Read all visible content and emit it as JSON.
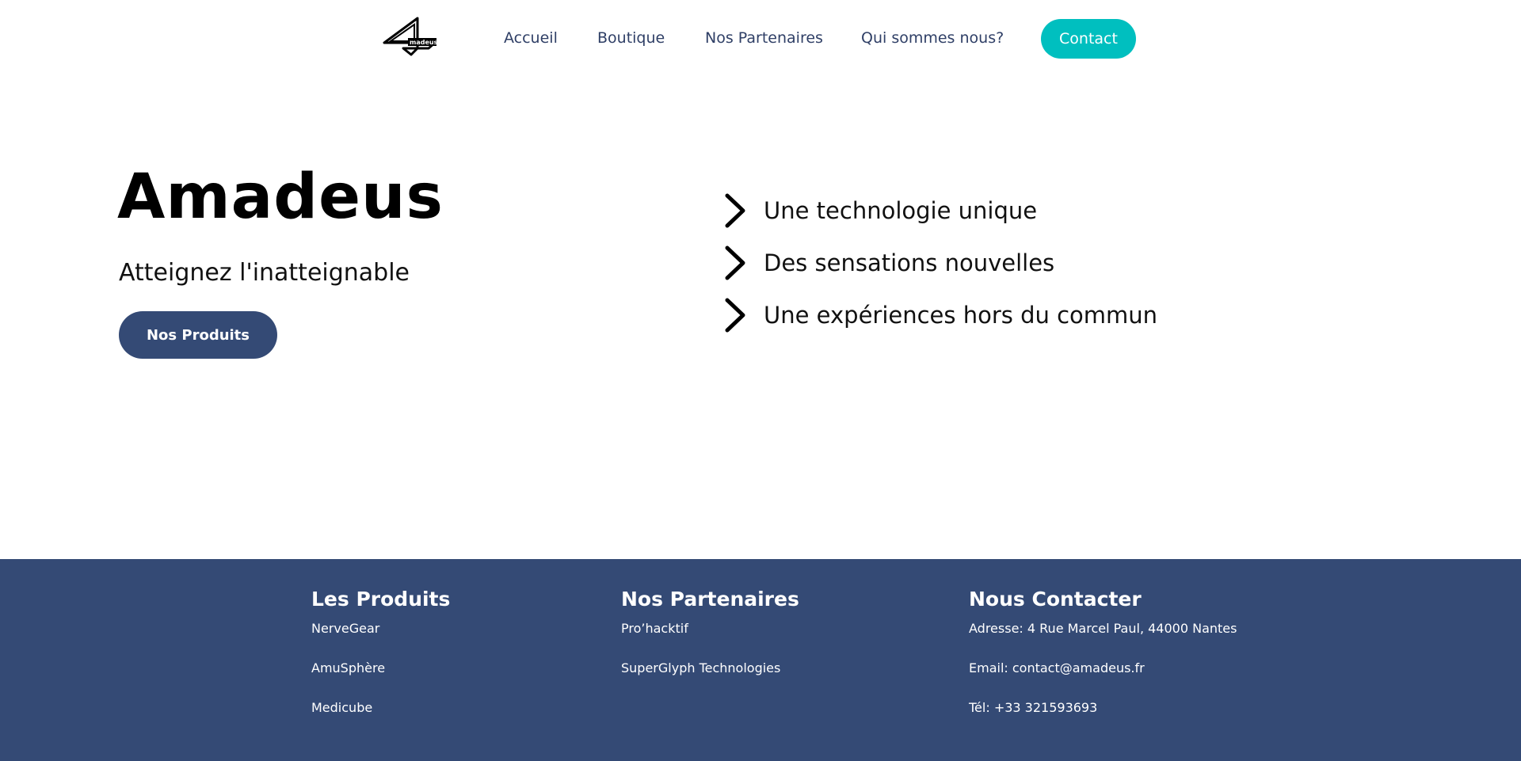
{
  "header": {
    "logo_alt": "Amadeus",
    "nav": [
      {
        "label": "Accueil"
      },
      {
        "label": "Boutique"
      },
      {
        "label": "Nos Partenaires"
      },
      {
        "label": "Qui sommes nous?"
      }
    ],
    "contact_label": "Contact"
  },
  "hero": {
    "title": "Amadeus",
    "subtitle": "Atteignez l'inatteignable",
    "cta_label": "Nos Produits",
    "features": [
      {
        "icon": "chevron-right-icon",
        "text": "Une technologie unique"
      },
      {
        "icon": "chevron-right-icon",
        "text": "Des sensations nouvelles"
      },
      {
        "icon": "chevron-right-icon",
        "text": "Une expériences hors du commun"
      }
    ]
  },
  "footer": {
    "products": {
      "title": "Les Produits",
      "items": [
        "NerveGear",
        "AmuSphère",
        "Medicube"
      ]
    },
    "partners": {
      "title": "Nos Partenaires",
      "items": [
        "Pro’hacktif",
        "SuperGlyph Technologies"
      ]
    },
    "contact": {
      "title": "Nous Contacter",
      "items": [
        "Adresse: 4 Rue Marcel Paul, 44000 Nantes",
        "Email: contact@amadeus.fr",
        "Tél: +33 321593693"
      ]
    }
  },
  "colors": {
    "nav_text": "#2f3f66",
    "contact_button": "#00bfbf",
    "primary": "#344a75",
    "footer_bg": "#344a75"
  }
}
